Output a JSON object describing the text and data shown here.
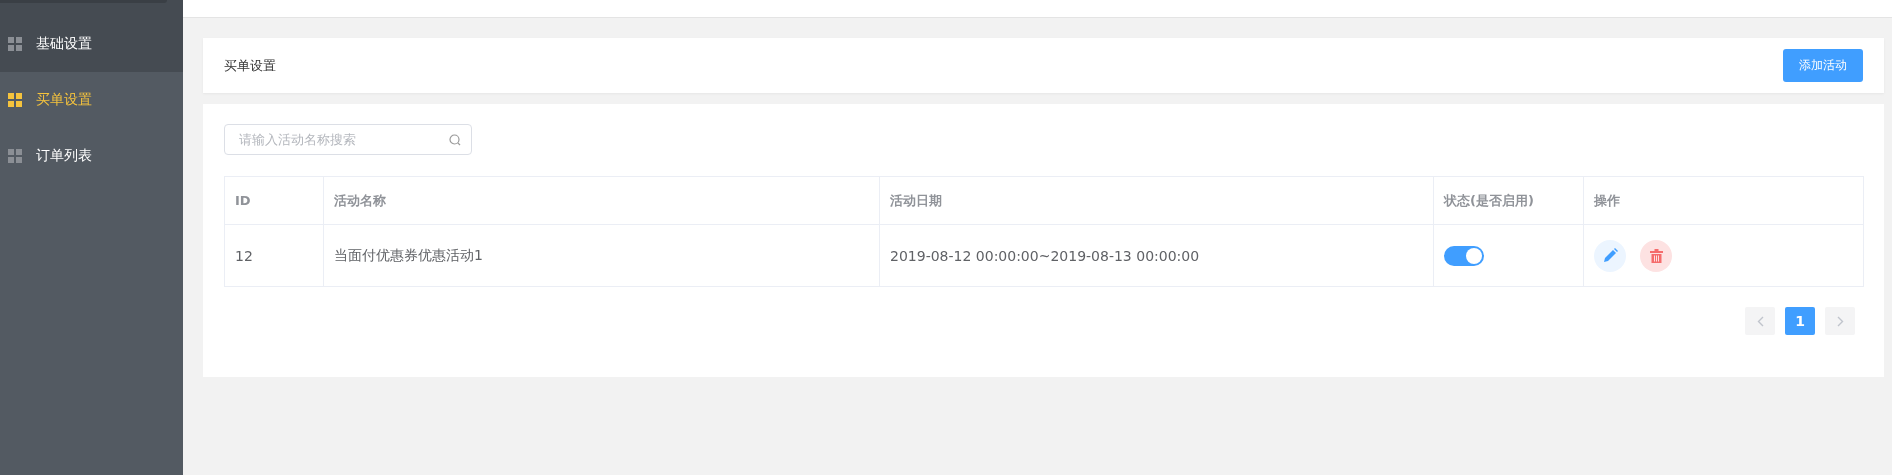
{
  "sidebar": {
    "items": [
      {
        "label": "基础设置",
        "selected": false
      },
      {
        "label": "买单设置",
        "selected": true
      },
      {
        "label": "订单列表",
        "selected": false
      }
    ]
  },
  "header": {
    "title": "买单设置",
    "button": "添加活动"
  },
  "search": {
    "placeholder": "请输入活动名称搜索"
  },
  "table": {
    "columns": [
      "ID",
      "活动名称",
      "活动日期",
      "状态(是否启用)",
      "操作"
    ],
    "rows": [
      {
        "id": "12",
        "name": "当面付优惠券优惠活动1",
        "date": "2019-08-12 00:00:00~2019-08-13 00:00:00",
        "enabled": true
      }
    ]
  },
  "pagination": {
    "pages": [
      {
        "label": "1",
        "selected": true
      }
    ]
  }
}
